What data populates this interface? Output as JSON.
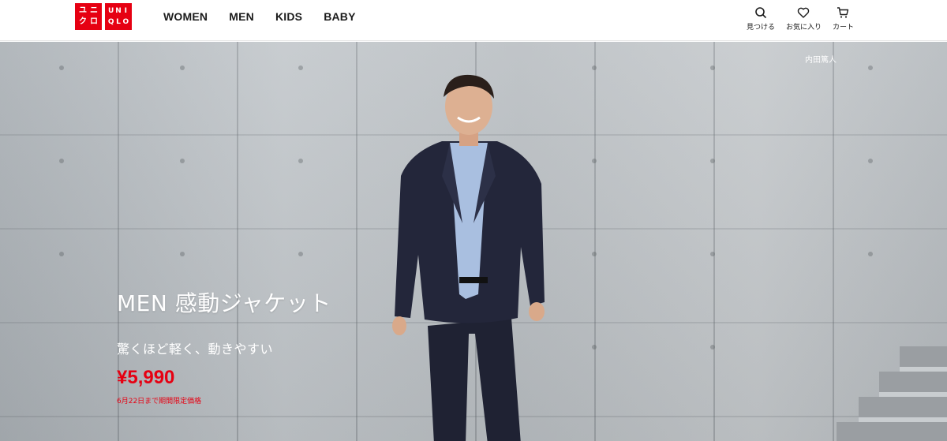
{
  "header": {
    "logo_left": [
      "ユ",
      "ニ",
      "ク",
      "ロ"
    ],
    "logo_right": [
      "U",
      "N",
      "I",
      "Q",
      "L",
      "O"
    ],
    "nav": [
      "WOMEN",
      "MEN",
      "KIDS",
      "BABY"
    ],
    "tools": {
      "search": "見つける",
      "favorites": "お気に入り",
      "cart": "カート"
    }
  },
  "hero": {
    "credit": "内田篤人",
    "title": "MEN 感動ジャケット",
    "subtitle": "驚くほど軽く、動きやすい",
    "price": "¥5,990",
    "note": "6月22日まで期間限定価格"
  },
  "colors": {
    "brand_red": "#e60012",
    "text_dark": "#1b1b1b"
  }
}
